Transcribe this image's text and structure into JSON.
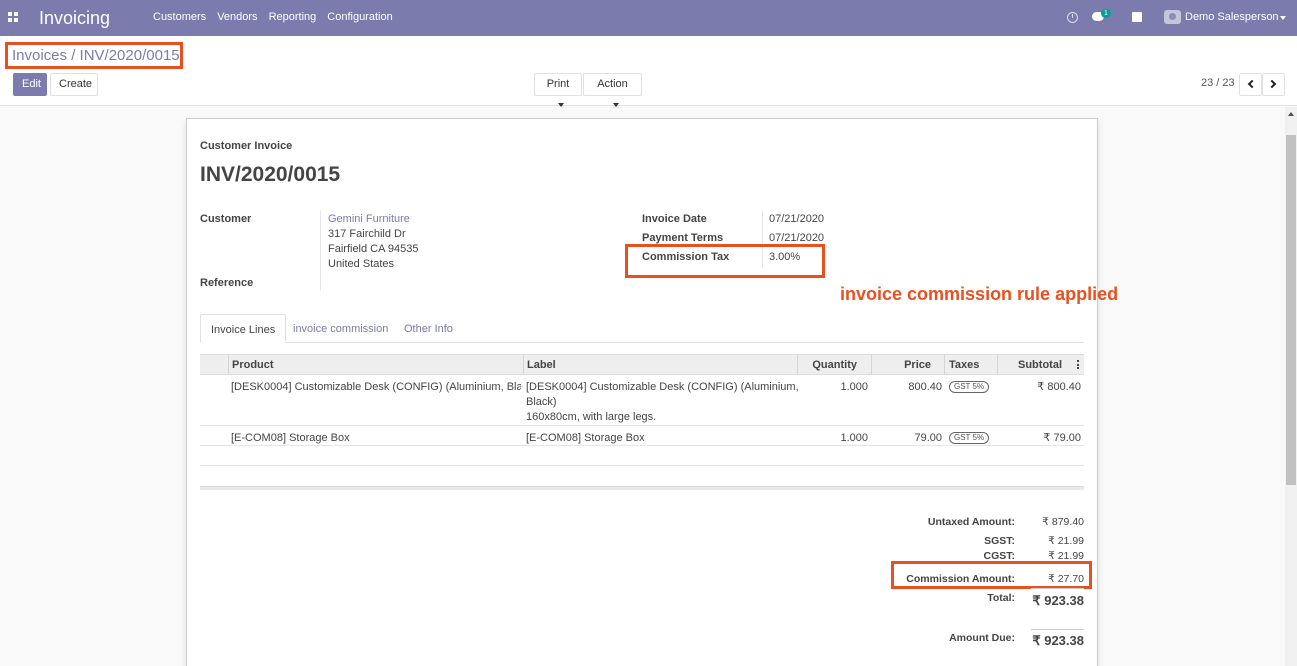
{
  "navbar": {
    "app_title": "Invoicing",
    "menu": [
      "Customers",
      "Vendors",
      "Reporting",
      "Configuration"
    ],
    "chat_badge": "1",
    "user": "Demo Salesperson"
  },
  "control": {
    "breadcrumb_parent": "Invoices",
    "breadcrumb_sep": "/",
    "breadcrumb_current": "INV/2020/0015",
    "edit_label": "Edit",
    "create_label": "Create",
    "print_label": "Print",
    "action_label": "Action",
    "pager": "23 / 23"
  },
  "invoice": {
    "doc_type": "Customer Invoice",
    "number": "INV/2020/0015",
    "customer_label": "Customer",
    "customer_name": "Gemini Furniture",
    "address_line1": "317 Fairchild Dr",
    "address_line2": "Fairfield CA 94535",
    "address_line3": "United States",
    "reference_label": "Reference",
    "invoice_date_label": "Invoice Date",
    "invoice_date": "07/21/2020",
    "payment_terms_label": "Payment Terms",
    "payment_terms": "07/21/2020",
    "commission_tax_label": "Commission Tax",
    "commission_tax": "3.00%"
  },
  "annotation": "invoice commission rule applied",
  "tabs": [
    "Invoice Lines",
    "invoice commission",
    "Other Info"
  ],
  "table": {
    "headers": [
      "Product",
      "Label",
      "Quantity",
      "Price",
      "Taxes",
      "Subtotal"
    ],
    "rows": [
      {
        "product": "[DESK0004] Customizable Desk (CONFIG) (Aluminium, Bla…",
        "label_line1": "[DESK0004] Customizable Desk (CONFIG) (Aluminium,",
        "label_line2": "Black)",
        "label_line3": "160x80cm, with large legs.",
        "quantity": "1.000",
        "price": "800.40",
        "tax": "GST 5%",
        "subtotal": "₹ 800.40"
      },
      {
        "product": "[E-COM08] Storage Box",
        "label_line1": "[E-COM08] Storage Box",
        "quantity": "1.000",
        "price": "79.00",
        "tax": "GST 5%",
        "subtotal": "₹ 79.00"
      }
    ]
  },
  "totals": {
    "untaxed_label": "Untaxed Amount:",
    "untaxed": "₹ 879.40",
    "sgst_label": "SGST:",
    "sgst": "₹ 21.99",
    "cgst_label": "CGST:",
    "cgst": "₹ 21.99",
    "commission_label": "Commission Amount:",
    "commission": "₹ 27.70",
    "total_label": "Total:",
    "total": "₹ 923.38",
    "amount_due_label": "Amount Due:",
    "amount_due": "₹ 923.38"
  },
  "colors": {
    "brand": "#7c7bad",
    "highlight": "#e8501f"
  }
}
